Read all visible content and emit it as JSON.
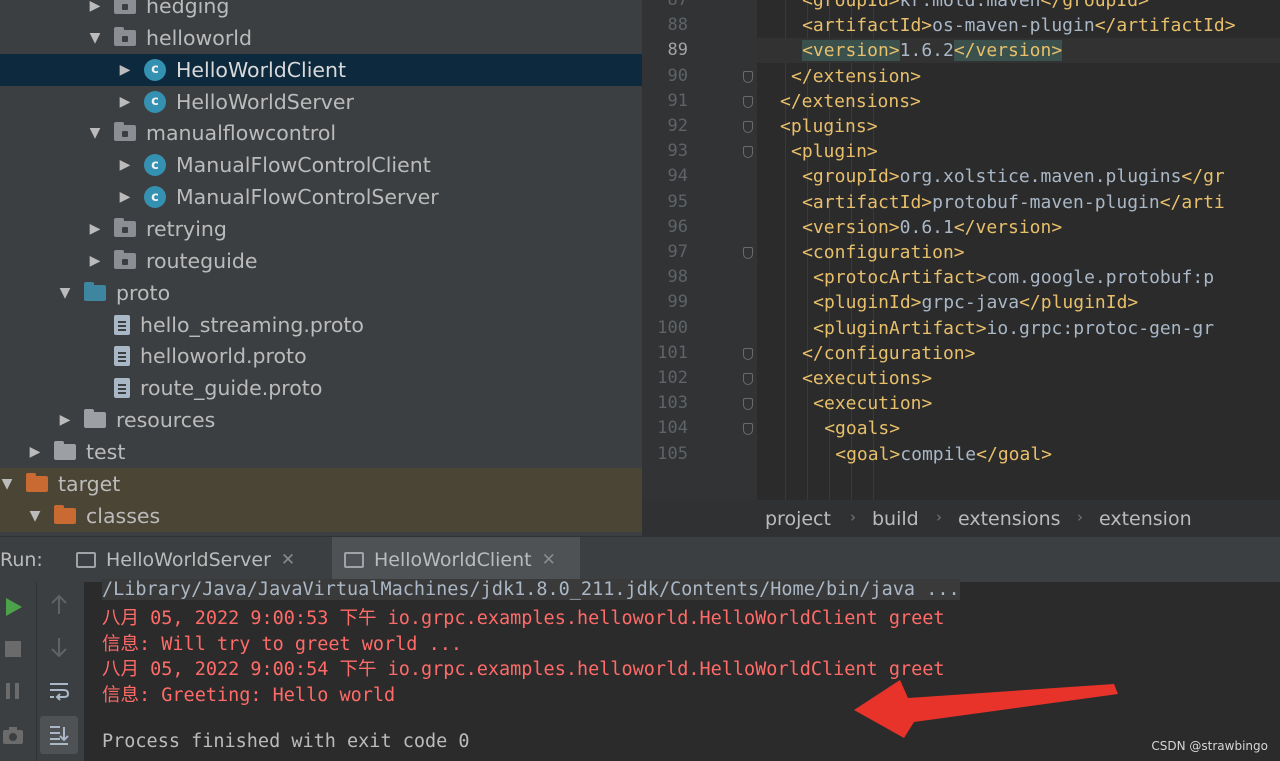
{
  "project_tree": {
    "items": [
      {
        "label": "hedging",
        "kind": "package",
        "expanded": false
      },
      {
        "label": "helloworld",
        "kind": "package",
        "expanded": true
      },
      {
        "label": "HelloWorldClient",
        "kind": "class",
        "expanded": false,
        "selected": true
      },
      {
        "label": "HelloWorldServer",
        "kind": "class",
        "expanded": false
      },
      {
        "label": "manualflowcontrol",
        "kind": "package",
        "expanded": true
      },
      {
        "label": "ManualFlowControlClient",
        "kind": "class",
        "expanded": false
      },
      {
        "label": "ManualFlowControlServer",
        "kind": "class",
        "expanded": false
      },
      {
        "label": "retrying",
        "kind": "package",
        "expanded": false
      },
      {
        "label": "routeguide",
        "kind": "package",
        "expanded": false
      },
      {
        "label": "proto",
        "kind": "source-folder",
        "expanded": true
      },
      {
        "label": "hello_streaming.proto",
        "kind": "file"
      },
      {
        "label": "helloworld.proto",
        "kind": "file"
      },
      {
        "label": "route_guide.proto",
        "kind": "file"
      },
      {
        "label": "resources",
        "kind": "resources-folder",
        "expanded": false
      },
      {
        "label": "test",
        "kind": "folder",
        "expanded": false
      },
      {
        "label": "target",
        "kind": "excluded-folder",
        "expanded": true
      },
      {
        "label": "classes",
        "kind": "excluded-folder",
        "expanded": true
      }
    ]
  },
  "editor": {
    "current_line": "89",
    "lines": [
      {
        "num": "88",
        "tag_open": "<artifactId>",
        "text": "os-maven-plugin",
        "tag_close": "</artifactId>"
      },
      {
        "num": "89",
        "tag_open": "<version>",
        "text": "1.6.2",
        "tag_close": "</version>"
      },
      {
        "num": "90",
        "tag_open": "</extension>",
        "text": "",
        "tag_close": ""
      },
      {
        "num": "91",
        "tag_open": "</extensions>",
        "text": "",
        "tag_close": ""
      },
      {
        "num": "92",
        "tag_open": "<plugins>",
        "text": "",
        "tag_close": ""
      },
      {
        "num": "93",
        "tag_open": "<plugin>",
        "text": "",
        "tag_close": ""
      },
      {
        "num": "94",
        "tag_open": "<groupId>",
        "text": "org.xolstice.maven.plugins",
        "tag_close": "</gr"
      },
      {
        "num": "95",
        "tag_open": "<artifactId>",
        "text": "protobuf-maven-plugin",
        "tag_close": "</arti"
      },
      {
        "num": "96",
        "tag_open": "<version>",
        "text": "0.6.1",
        "tag_close": "</version>"
      },
      {
        "num": "97",
        "tag_open": "<configuration>",
        "text": "",
        "tag_close": ""
      },
      {
        "num": "98",
        "tag_open": "<protocArtifact>",
        "text": "com.google.protobuf:p",
        "tag_close": ""
      },
      {
        "num": "99",
        "tag_open": "<pluginId>",
        "text": "grpc-java",
        "tag_close": "</pluginId>"
      },
      {
        "num": "100",
        "tag_open": "<pluginArtifact>",
        "text": "io.grpc:protoc-gen-gr",
        "tag_close": ""
      },
      {
        "num": "101",
        "tag_open": "</configuration>",
        "text": "",
        "tag_close": ""
      },
      {
        "num": "102",
        "tag_open": "<executions>",
        "text": "",
        "tag_close": ""
      },
      {
        "num": "103",
        "tag_open": "<execution>",
        "text": "",
        "tag_close": ""
      },
      {
        "num": "104",
        "tag_open": "<goals>",
        "text": "",
        "tag_close": ""
      },
      {
        "num": "105",
        "tag_open": "<goal>",
        "text": "compile",
        "tag_close": "</goal>"
      }
    ],
    "top_partial": {
      "num": "87",
      "tag_open": "<groupId>",
      "text": "kr.motd.maven",
      "tag_close": "</groupId>"
    }
  },
  "breadcrumb": [
    "project",
    "build",
    "extensions",
    "extension"
  ],
  "run_panel": {
    "label": "Run:",
    "tabs": [
      {
        "label": "HelloWorldServer",
        "active": false
      },
      {
        "label": "HelloWorldClient",
        "active": true
      }
    ],
    "console": [
      {
        "text": "/Library/Java/JavaVirtualMachines/jdk1.8.0_211.jdk/Contents/Home/bin/java ...",
        "style": "path"
      },
      {
        "text": "八月 05, 2022 9:00:53 下午 io.grpc.examples.helloworld.HelloWorldClient greet",
        "style": "err"
      },
      {
        "text": "信息: Will try to greet world ...",
        "style": "err"
      },
      {
        "text": "八月 05, 2022 9:00:54 下午 io.grpc.examples.helloworld.HelloWorldClient greet",
        "style": "err"
      },
      {
        "text": "信息: Greeting: Hello world",
        "style": "err"
      },
      {
        "text": "",
        "style": "norm"
      },
      {
        "text": "Process finished with exit code 0",
        "style": "norm"
      }
    ]
  },
  "colors": {
    "accent_annotation": "#e8332a",
    "console_error": "#ff6b68",
    "xml_tag": "#e8bf6a"
  },
  "watermark": "CSDN @strawbingo"
}
